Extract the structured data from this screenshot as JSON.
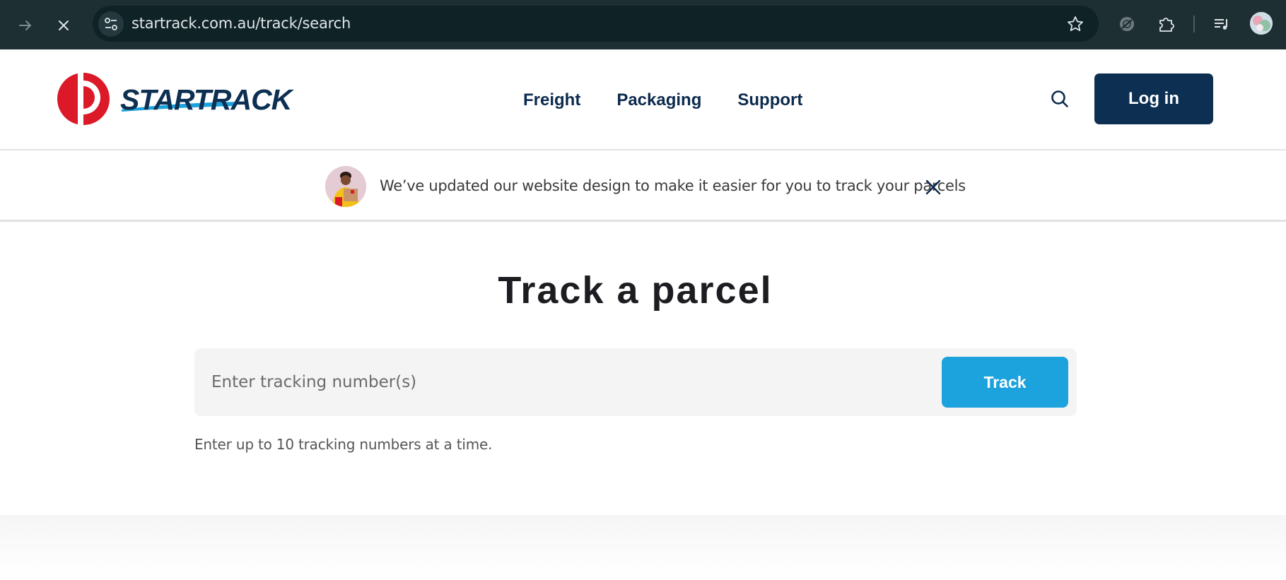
{
  "browser": {
    "url": "startrack.com.au/track/search"
  },
  "header": {
    "brand_name": "STARTRACK",
    "nav": [
      {
        "label": "Freight"
      },
      {
        "label": "Packaging"
      },
      {
        "label": "Support"
      }
    ],
    "login_label": "Log in"
  },
  "notice": {
    "message": "We’ve updated our website design to make it easier for you to track your parcels"
  },
  "main": {
    "title": "Track a parcel",
    "input_placeholder": "Enter tracking number(s)",
    "track_label": "Track",
    "helper_text": "Enter up to 10 tracking numbers at a time."
  },
  "colors": {
    "brand_navy": "#0c2f52",
    "brand_blue": "#1ca2dc",
    "brand_red": "#dc1928"
  }
}
